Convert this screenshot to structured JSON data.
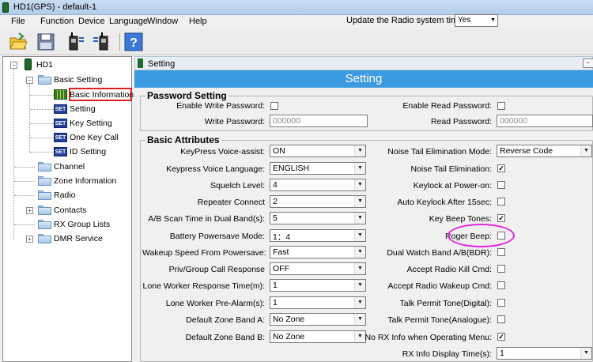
{
  "window": {
    "title": "HD1(GPS) - default-1"
  },
  "menu": {
    "items": [
      "File",
      "Function",
      "Device",
      "Language",
      "Window",
      "Help"
    ]
  },
  "update_option": {
    "label": "Update the Radio system time",
    "value": "Yes"
  },
  "toolbar": {
    "buttons": [
      "open-icon",
      "save-icon",
      "read-radio-icon",
      "write-radio-icon",
      "help-icon"
    ]
  },
  "tree": {
    "root": "HD1",
    "basic_setting": "Basic Setting",
    "basic_children": [
      "Basic Information",
      "Setting",
      "Key Setting",
      "One Key Call",
      "ID Setting"
    ],
    "basic_child_icons": [
      "grid",
      "SET",
      "SET",
      "SET",
      "SET"
    ],
    "others": [
      "Channel",
      "Zone Information",
      "Radio",
      "Contacts",
      "RX Group Lists",
      "DMR Service"
    ]
  },
  "panel": {
    "tab_title": "Setting",
    "banner": "Setting",
    "close": "-"
  },
  "password": {
    "title": "Password Setting",
    "enable_write_label": "Enable Write Password:",
    "enable_read_label": "Enable Read Password:",
    "write_label": "Write Password:",
    "write_value": "000000",
    "read_label": "Read Password:",
    "read_value": "000000"
  },
  "basic": {
    "title": "Basic Attributes",
    "left": [
      {
        "label": "KeyPress Voice-assist:",
        "value": "ON"
      },
      {
        "label": "Keypress Voice Language:",
        "value": "ENGLISH"
      },
      {
        "label": "Squelch Level:",
        "value": "4"
      },
      {
        "label": "Repeater Connect",
        "value": "2"
      },
      {
        "label": "A/B Scan Time in Dual Band(s):",
        "value": "5"
      },
      {
        "label": "Battery Powersave Mode:",
        "value": "1：4"
      },
      {
        "label": "Wakeup Speed From Powersave:",
        "value": "Fast"
      },
      {
        "label": "Priv/Group Call Response",
        "value": "OFF"
      },
      {
        "label": "Lone Worker Response Time(m):",
        "value": "1"
      },
      {
        "label": "Lone Worker Pre-Alarm(s):",
        "value": "1"
      },
      {
        "label": "Default Zone Band A:",
        "value": "No Zone"
      },
      {
        "label": "Default Zone Band B:",
        "value": "No Zone"
      }
    ],
    "noise_mode": {
      "label": "Noise Tail Elimination Mode:",
      "value": "Reverse Code"
    },
    "right_checks": [
      {
        "label": "Noise Tail Elimination:",
        "checked": "✓"
      },
      {
        "label": "Keylock at Power-on:",
        "checked": ""
      },
      {
        "label": "Auto Keylock After 15sec:",
        "checked": ""
      },
      {
        "label": "Key Beep Tones:",
        "checked": "✓"
      },
      {
        "label": "Roger Beep:",
        "checked": ""
      },
      {
        "label": "Dual Watch Band A/B(BDR):",
        "checked": ""
      },
      {
        "label": "Accept Radio Kill Cmd:",
        "checked": ""
      },
      {
        "label": "Accept Radio Wakeup Cmd:",
        "checked": ""
      },
      {
        "label": "Talk Permit Tone(Digital):",
        "checked": ""
      },
      {
        "label": "Talk Permit Tone(Analogue):",
        "checked": ""
      },
      {
        "label": "No RX Info when Operating Menu:",
        "checked": "✓"
      }
    ],
    "rx_info": {
      "label": "RX Info Display Time(s):",
      "value": "1"
    }
  }
}
